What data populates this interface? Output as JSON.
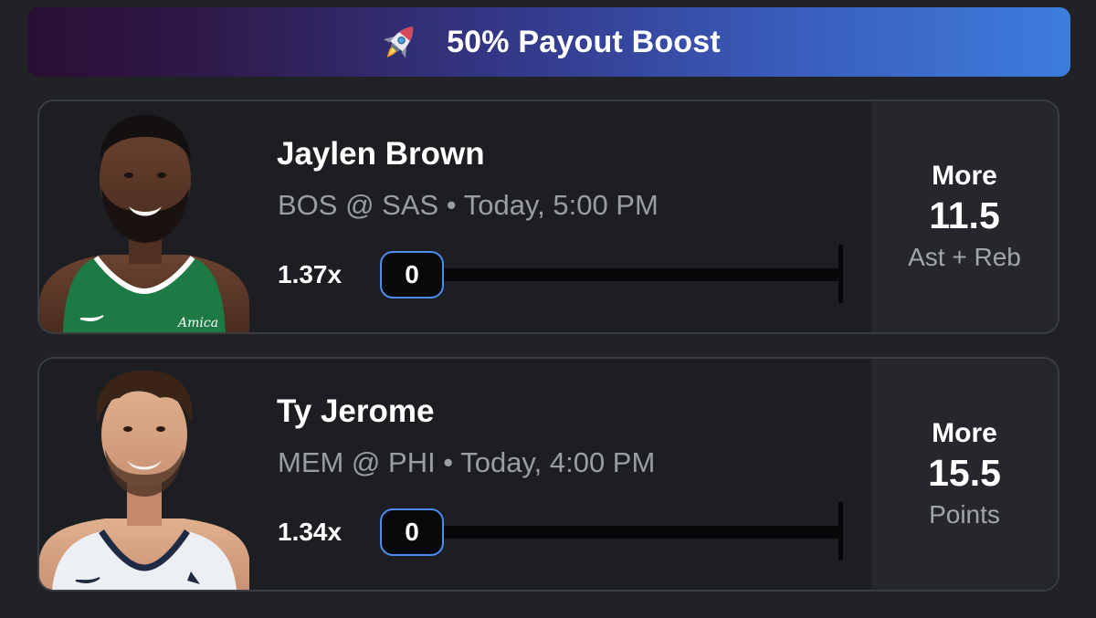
{
  "banner": {
    "icon": "rocket-icon",
    "text": "50% Payout Boost",
    "gradient": [
      "#2b0e33",
      "#343a8c",
      "#3d7ddb"
    ]
  },
  "picks": [
    {
      "player_name": "Jaylen Brown",
      "game_info": "BOS @ SAS • Today, 5:00 PM",
      "multiplier": "1.37x",
      "progress_value": "0",
      "progress_fraction": 0,
      "direction": "More",
      "line": "11.5",
      "stat": "Ast + Reb",
      "avatar_jersey_color": "#1d7a45",
      "avatar_jersey_text": "Amica"
    },
    {
      "player_name": "Ty Jerome",
      "game_info": "MEM @ PHI • Today, 4:00 PM",
      "multiplier": "1.34x",
      "progress_value": "0",
      "progress_fraction": 0,
      "direction": "More",
      "line": "15.5",
      "stat": "Points",
      "avatar_jersey_color": "#eceff3"
    }
  ],
  "colors": {
    "background": "#202226",
    "card": "#1c1e22",
    "card_border": "#3a3d43",
    "accent": "#4c8df0",
    "muted_text": "#9a9da3"
  }
}
